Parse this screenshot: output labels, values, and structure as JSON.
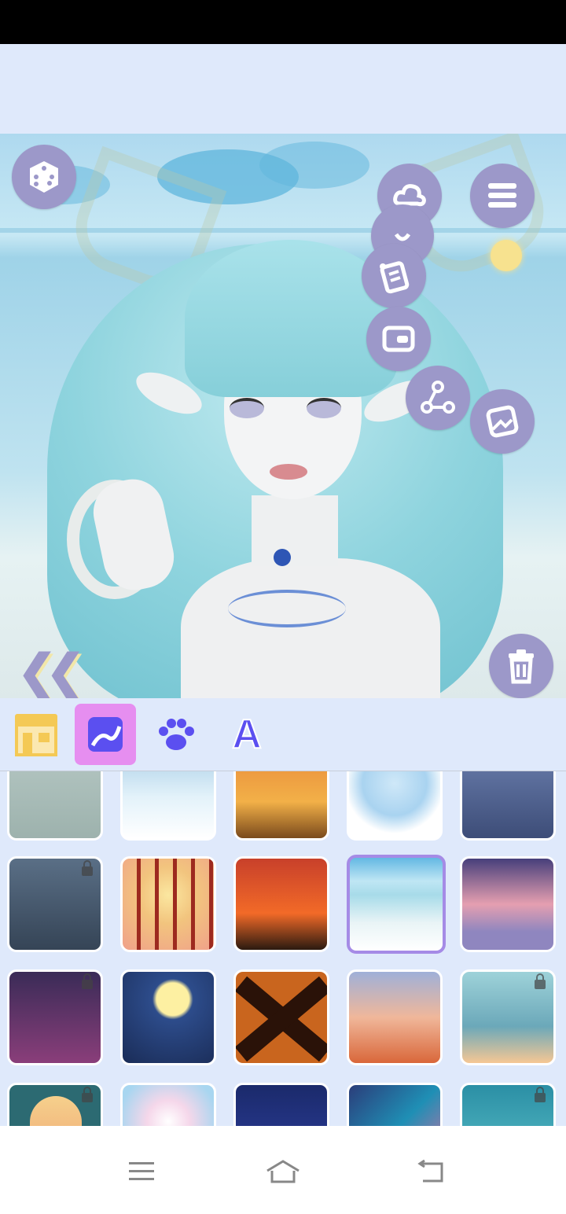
{
  "canvas": {
    "toolbar_icons": [
      "dice-icon",
      "weather-icon",
      "list-icon",
      "checklist-icon",
      "wallet-icon",
      "share-icon",
      "image-icon",
      "trash-icon",
      "collapse-icon"
    ]
  },
  "tabs": [
    {
      "name": "shop",
      "icon": "shop-icon",
      "active": false
    },
    {
      "name": "background",
      "icon": "background-icon",
      "active": true
    },
    {
      "name": "pets",
      "icon": "paw-icon",
      "active": false
    },
    {
      "name": "text",
      "icon": "text-a-icon",
      "active": false,
      "label": "A"
    }
  ],
  "backgrounds": [
    {
      "id": "bg-window-grid",
      "locked": false,
      "selected": false
    },
    {
      "id": "bg-snow-lake",
      "locked": false,
      "selected": false
    },
    {
      "id": "bg-sunset-field",
      "locked": false,
      "selected": false
    },
    {
      "id": "bg-snow-globe",
      "locked": false,
      "selected": false
    },
    {
      "id": "bg-night-ruins",
      "locked": false,
      "selected": false
    },
    {
      "id": "bg-whale-shipwreck",
      "locked": true,
      "selected": false
    },
    {
      "id": "bg-cage-moon",
      "locked": false,
      "selected": false
    },
    {
      "id": "bg-fire",
      "locked": false,
      "selected": false
    },
    {
      "id": "bg-beach-sky",
      "locked": false,
      "selected": true
    },
    {
      "id": "bg-pink-mountains",
      "locked": false,
      "selected": false
    },
    {
      "id": "bg-neon-city",
      "locked": true,
      "selected": false
    },
    {
      "id": "bg-moon-city",
      "locked": false,
      "selected": false
    },
    {
      "id": "bg-x-mark",
      "locked": false,
      "selected": false
    },
    {
      "id": "bg-flamingo-sky",
      "locked": false,
      "selected": false
    },
    {
      "id": "bg-mushroom",
      "locked": true,
      "selected": false
    },
    {
      "id": "bg-arch-door",
      "locked": true,
      "selected": false
    },
    {
      "id": "bg-clouds",
      "locked": false,
      "selected": false
    },
    {
      "id": "bg-night-clouds",
      "locked": false,
      "selected": false
    },
    {
      "id": "bg-coral-sky",
      "locked": false,
      "selected": false
    },
    {
      "id": "bg-underwater",
      "locked": true,
      "selected": false
    }
  ],
  "colors": {
    "accent": "#9c98c9",
    "tab_active": "#e68ef0",
    "selected_border": "#a58be6",
    "background": "#dfe9fb"
  }
}
